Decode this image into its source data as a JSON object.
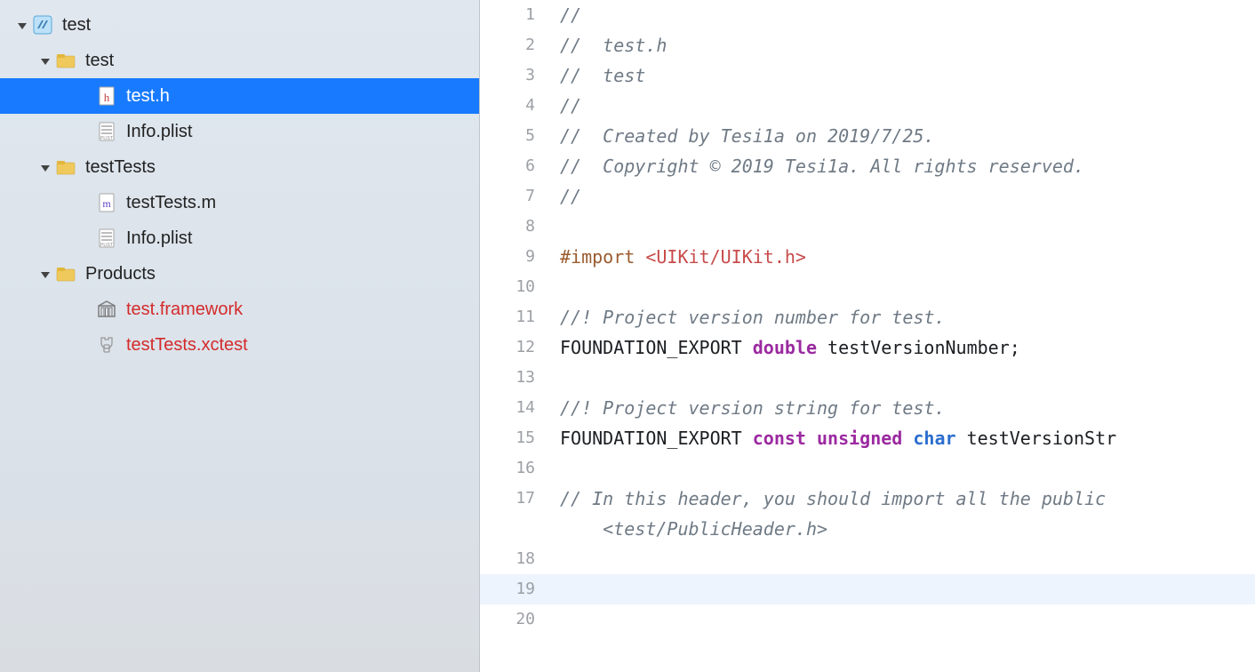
{
  "navigator": {
    "root": {
      "label": "test"
    },
    "test_folder": {
      "label": "test"
    },
    "test_h": {
      "label": "test.h"
    },
    "info_plist_1": {
      "label": "Info.plist"
    },
    "testTests_folder": {
      "label": "testTests"
    },
    "testTests_m": {
      "label": "testTests.m"
    },
    "info_plist_2": {
      "label": "Info.plist"
    },
    "products_folder": {
      "label": "Products"
    },
    "test_framework": {
      "label": "test.framework"
    },
    "testTests_xctest": {
      "label": "testTests.xctest"
    }
  },
  "code": {
    "l1": "//",
    "l2": "//  test.h",
    "l3": "//  test",
    "l4": "//",
    "l5": "//  Created by Tesi1a on 2019/7/25.",
    "l6": "//  Copyright © 2019 Tesi1a. All rights reserved.",
    "l7": "//",
    "l8": "",
    "l9a": "#import ",
    "l9b": "<UIKit/UIKit.h>",
    "l10": "",
    "l11": "//! Project version number for test.",
    "l12a": "FOUNDATION_EXPORT ",
    "l12b": "double",
    "l12c": " testVersionNumber;",
    "l13": "",
    "l14": "//! Project version string for test.",
    "l15a": "FOUNDATION_EXPORT ",
    "l15b": "const",
    "l15c": " ",
    "l15d": "unsigned",
    "l15e": " ",
    "l15f": "char",
    "l15g": " testVersionStr",
    "l16": "",
    "l17a": "// In this header, you should import all the public ",
    "l17b": "<test/PublicHeader.h>",
    "l18": "",
    "l19": "",
    "l20": ""
  },
  "ln": {
    "1": "1",
    "2": "2",
    "3": "3",
    "4": "4",
    "5": "5",
    "6": "6",
    "7": "7",
    "8": "8",
    "9": "9",
    "10": "10",
    "11": "11",
    "12": "12",
    "13": "13",
    "14": "14",
    "15": "15",
    "16": "16",
    "17": "17",
    "18": "18",
    "19": "19",
    "20": "20"
  }
}
